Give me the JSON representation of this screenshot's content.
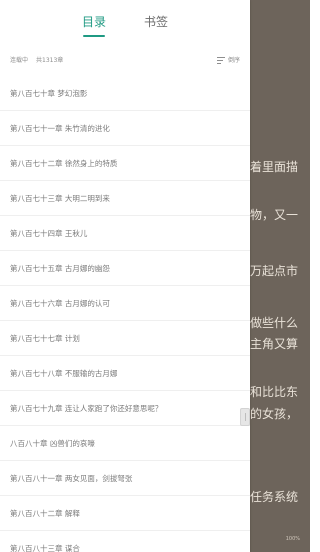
{
  "tabs": [
    {
      "label": "目录"
    },
    {
      "label": "书签"
    }
  ],
  "meta": {
    "status": "连载中",
    "total": "共1313章",
    "sort_label": "倒序"
  },
  "chapters": [
    "第八百七十章 梦幻泡影",
    "第八百七十一章 朱竹清的进化",
    "第八百七十二章 徐然身上的特质",
    "第八百七十三章 大明二明到来",
    "第八百七十四章 王秋儿",
    "第八百七十五章 古月娜的幽怨",
    "第八百七十六章 古月娜的认可",
    "第八百七十七章 计划",
    "第八百七十八章 不服输的古月娜",
    "第八百七十九章 连让人家跑了你还好意思呢？",
    "八百八十章 凶兽们的哀嚎",
    "第八百八十一章 两女见面，剑拔弩张",
    "第八百八十二章 解释",
    "第八百八十三章 谋合"
  ],
  "reader": {
    "lines": [
      "着里面描",
      "物，又一",
      "万起点市",
      "做些什么",
      "主角又算",
      "和比比东",
      "的女孩，",
      "任务系统"
    ],
    "battery": "100%"
  }
}
